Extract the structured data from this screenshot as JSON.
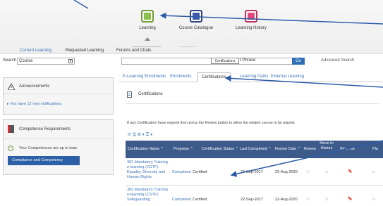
{
  "top_apps": [
    {
      "label": "Learning",
      "color": "#8cc04f"
    },
    {
      "label": "Course Catalogue",
      "color": "#3f5aa8"
    },
    {
      "label": "Learning History",
      "color": "#e4487a"
    }
  ],
  "nav": {
    "current_learning": "Current Learning",
    "requested_learning": "Requested Learning",
    "forums": "Forums and Chats"
  },
  "search": {
    "scope": "Course",
    "tooltip": "Certifications",
    "phrase": "t Phrase",
    "go": "Go",
    "advanced": "Advanced Search"
  },
  "left": {
    "announcements_title": "Announcements",
    "notifications": "You have 12 new notifications.",
    "competence_title": "Competence Requirements",
    "competence_status": "Your Competences are up to date.",
    "compliance_button": "Compliance and Competency"
  },
  "tabs": [
    "E-Learning Enrolments",
    "Enrolments",
    "Certifications",
    "Learning Paths",
    "External Learning"
  ],
  "active_tab": "Certifications",
  "cert_title": "Certifications",
  "note": "If any Certification have expired then press the Renew button to allow the related course to be played.",
  "toolbar": "⟳ 🖫 ⚙ ▾ ☰ ▾",
  "table": {
    "headers": {
      "name": "Certification Name ⌃",
      "progress": "Progress ⌃",
      "status": "Certification Status ⌃",
      "last": "Last Completed ⌃",
      "renew_date": "Renew Date ⌃",
      "renew": "Renew",
      "move": "Move to History",
      "extra": "Wo... ew",
      "pla": "Pla"
    },
    "rows": [
      {
        "name": "382 Mandatory Training e-learning (CSTF): Equality, Diversity and Human Rights",
        "progress": "Completed",
        "status": "Certified",
        "last": "22-Sep-2017",
        "renew": "22-Aug-2020"
      },
      {
        "name": "382 Mandatory Training e-learning (CSTF): Safeguarding",
        "progress": "Completed",
        "status": "Certified",
        "last": "22-Sep-2017",
        "renew": "22-Aug-2020"
      }
    ]
  },
  "colors": {
    "accent": "#3b73b9",
    "header": "#3c5a8a",
    "button": "#2b5fa6"
  }
}
